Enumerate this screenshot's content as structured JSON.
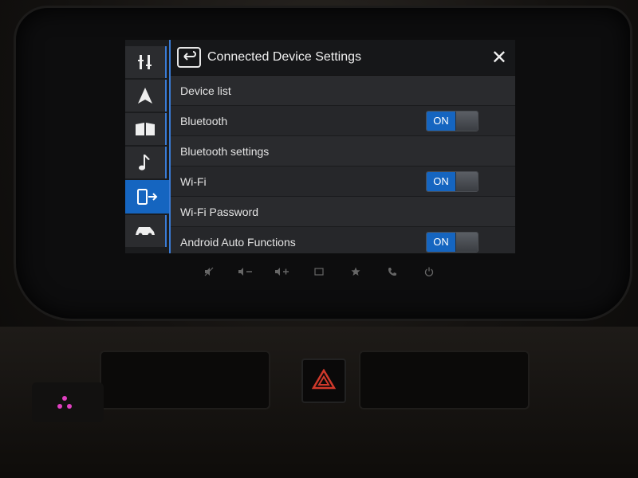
{
  "header": {
    "title": "Connected Device Settings"
  },
  "sidebar": {
    "items": [
      {
        "icon": "tools-icon",
        "active": false
      },
      {
        "icon": "navigation-icon",
        "active": false
      },
      {
        "icon": "map-book-icon",
        "active": false
      },
      {
        "icon": "music-note-icon",
        "active": false
      },
      {
        "icon": "connected-device-icon",
        "active": true
      },
      {
        "icon": "car-icon",
        "active": false
      }
    ]
  },
  "rows": [
    {
      "label": "Device list",
      "type": "group"
    },
    {
      "label": "Bluetooth",
      "type": "toggle",
      "state": "ON"
    },
    {
      "label": "Bluetooth settings",
      "type": "group"
    },
    {
      "label": "Wi-Fi",
      "type": "toggle",
      "state": "ON"
    },
    {
      "label": "Wi-Fi Password",
      "type": "group"
    },
    {
      "label": "Android Auto Functions",
      "type": "toggle",
      "state": "ON"
    }
  ],
  "colors": {
    "accent": "#1565c0",
    "background": "#26272a",
    "header": "#161719"
  }
}
